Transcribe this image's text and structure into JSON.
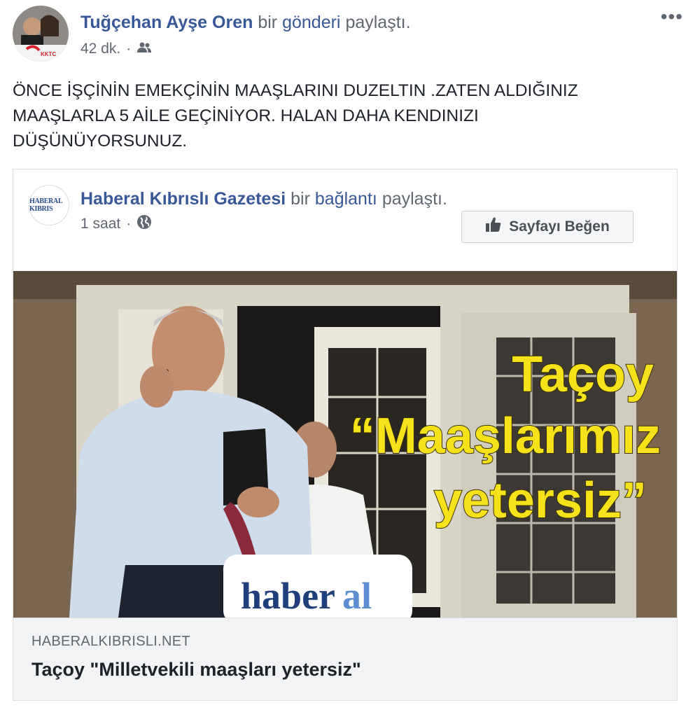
{
  "post": {
    "author": "Tuğçehan Ayşe Oren",
    "action_prefix": "bir",
    "action_link": "gönderi",
    "action_suffix": "paylaştı.",
    "time": "42 dk.",
    "sep": "·",
    "more": "•••",
    "avatar_badge_text": "KKTC",
    "text": "ÖNCE İŞÇİNİN EMEKÇİNİN MAAŞLARINI DUZELTIN .ZATEN ALDIĞINIZ\nMAAŞLARLA 5 AİLE GEÇİNİYOR. HALAN DAHA KENDINIZI\nDÜŞÜNÜYORSUNUZ."
  },
  "shared": {
    "page_name": "Haberal Kıbrıslı Gazetesi",
    "action_prefix": "bir",
    "action_link": "bağlantı",
    "action_suffix": "paylaştı.",
    "time": "1 saat",
    "sep": "·",
    "logo_text": "HABERAL KIBRIS",
    "like_button": "Sayfayı Beğen",
    "image": {
      "headline_line1": "Taçoy",
      "headline_line2": "“Maaşlarımız",
      "headline_line3": "yetersiz”",
      "brand_left": "haber",
      "brand_right": "al"
    },
    "link": {
      "domain": "HABERALKIBRISLI.NET",
      "title": "Taçoy \"Milletvekili maaşları yetersiz\""
    }
  },
  "colors": {
    "link": "#385898",
    "muted": "#616770",
    "headline_yellow": "#f6e21a"
  }
}
